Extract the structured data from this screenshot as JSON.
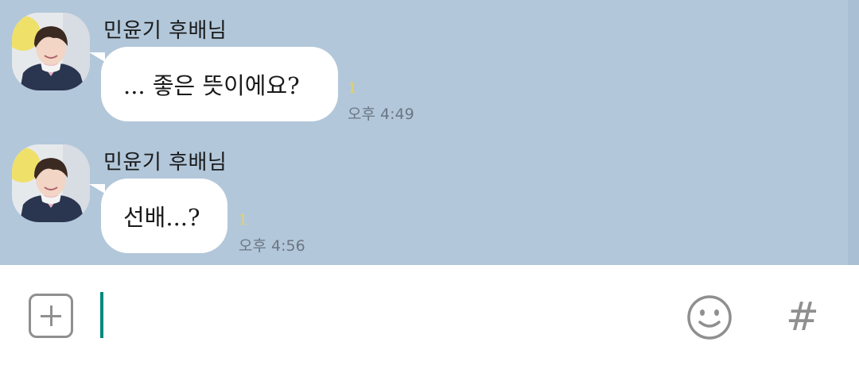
{
  "messages": [
    {
      "sender": "민윤기 후배님",
      "text": "... 좋은 뜻이에요?",
      "unread": "1",
      "time": "오후 4:49"
    },
    {
      "sender": "민윤기 후배님",
      "text": "선배...?",
      "unread": "1",
      "time": "오후 4:56"
    }
  ],
  "composer": {
    "attach_icon": "plus-square-icon",
    "emoji_icon": "smiley-icon",
    "hash_icon": "hash-icon",
    "hash_glyph": "#"
  },
  "colors": {
    "chat_background": "#b2c7da",
    "bubble": "#ffffff",
    "unread_count": "#e7d35a",
    "cursor": "#00897b",
    "icon_gray": "#8f8f8f"
  }
}
